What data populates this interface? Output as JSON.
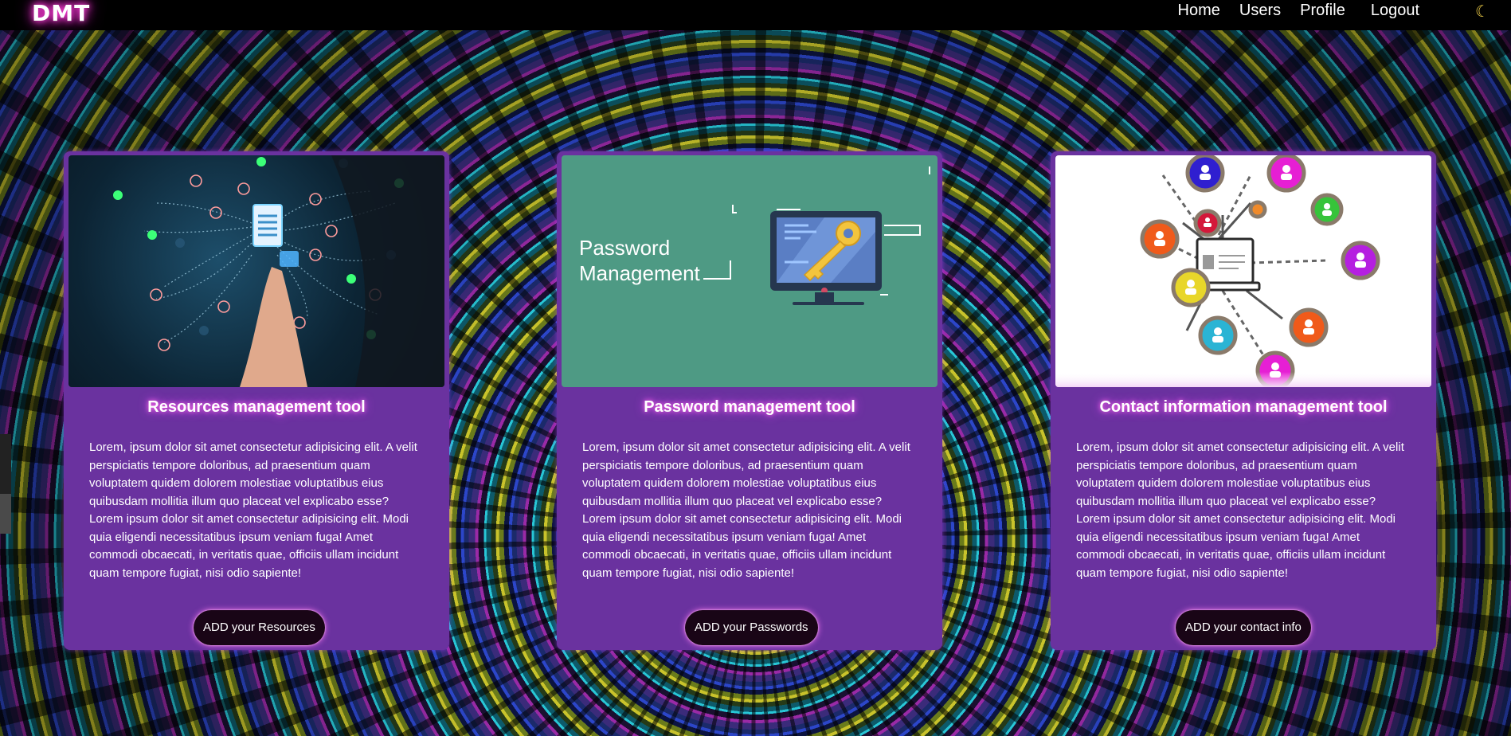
{
  "nav": {
    "logo": "DMT",
    "links": [
      {
        "label": "Home"
      },
      {
        "label": "Users"
      },
      {
        "label": "Profile"
      },
      {
        "label": "Logout"
      }
    ],
    "theme_icon": "moon-icon"
  },
  "cards": [
    {
      "title": "Resources management tool",
      "description": "Lorem, ipsum dolor sit amet consectetur adipisicing elit. A velit perspiciatis tempore doloribus, ad praesentium quam voluptatem quidem dolorem molestiae voluptatibus eius quibusdam mollitia illum quo placeat vel explicabo esse? Lorem ipsum dolor sit amet consectetur adipisicing elit. Modi quia eligendi necessitatibus ipsum veniam fuga! Amet commodi obcaecati, in veritatis quae, officiis ullam incidunt quam tempore fugiat, nisi odio sapiente!",
      "button": "ADD your Resources",
      "image_icon": "document-network-icon"
    },
    {
      "title": "Password management tool",
      "description": "Lorem, ipsum dolor sit amet consectetur adipisicing elit. A velit perspiciatis tempore doloribus, ad praesentium quam voluptatem quidem dolorem molestiae voluptatibus eius quibusdam mollitia illum quo placeat vel explicabo esse? Lorem ipsum dolor sit amet consectetur adipisicing elit. Modi quia eligendi necessitatibus ipsum veniam fuga! Amet commodi obcaecati, in veritatis quae, officiis ullam incidunt quam tempore fugiat, nisi odio sapiente!",
      "button": "ADD your Passwords",
      "image_text": "Password Management",
      "image_icon": "monitor-key-icon"
    },
    {
      "title": "Contact information management tool",
      "description": "Lorem, ipsum dolor sit amet consectetur adipisicing elit. A velit perspiciatis tempore doloribus, ad praesentium quam voluptatem quidem dolorem molestiae voluptatibus eius quibusdam mollitia illum quo placeat vel explicabo esse? Lorem ipsum dolor sit amet consectetur adipisicing elit. Modi quia eligendi necessitatibus ipsum veniam fuga! Amet commodi obcaecati, in veritatis quae, officiis ullam incidunt quam tempore fugiat, nisi odio sapiente!",
      "button": "ADD your contact info",
      "image_icon": "contact-network-icon"
    }
  ],
  "colors": {
    "card": "#6a329f",
    "nav": "#000000",
    "glow": "#ff3fd8",
    "button": "#190516"
  }
}
